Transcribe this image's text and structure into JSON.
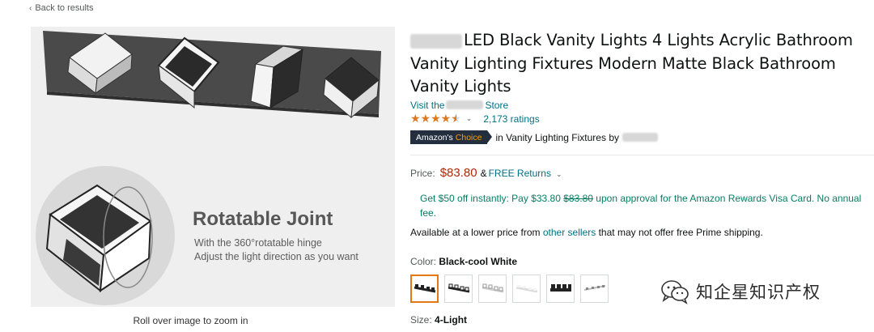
{
  "nav": {
    "back_label": "Back to results"
  },
  "image": {
    "overlay_title": "Rotatable Joint",
    "overlay_line1": "With the 360°rotatable hinge",
    "overlay_line2": "Adjust the light direction as you want",
    "zoom_hint": "Roll over image to zoom in"
  },
  "product": {
    "title_visible": "LED Black Vanity Lights 4 Lights Acrylic Bathroom Vanity Lighting Fixtures Modern Matte Black Bathroom Vanity Lights",
    "store_prefix": "Visit the",
    "store_suffix": "Store",
    "rating_stars": 4.5,
    "ratings_count": "2,173 ratings",
    "badge_prefix": "Amazon's",
    "badge_choice": "Choice",
    "choice_category": "in Vanity Lighting Fixtures by"
  },
  "pricing": {
    "label": "Price:",
    "price": "$83.80",
    "amp": "&",
    "returns": "FREE Returns",
    "promo_prefix": "Get $50 off instantly: Pay $33.80",
    "promo_strike": "$83.80",
    "promo_suffix": "upon approval for the Amazon Rewards Visa Card. No annual fee.",
    "avail_prefix": "Available at a lower price from",
    "avail_link": "other sellers",
    "avail_suffix": "that may not offer free Prime shipping."
  },
  "variant": {
    "color_label": "Color:",
    "color_value": "Black-cool White",
    "swatch_count": 6,
    "selected_swatch": 1,
    "size_label": "Size:",
    "size_value": "4-Light"
  },
  "watermark": {
    "text": "知企星知识产权"
  },
  "colors": {
    "link": "#007185",
    "price": "#b12704",
    "promo": "#067d62",
    "badge_bg": "#232f3e",
    "badge_accent": "#ff9900",
    "star": "#de7921",
    "selected_border": "#e47911"
  }
}
